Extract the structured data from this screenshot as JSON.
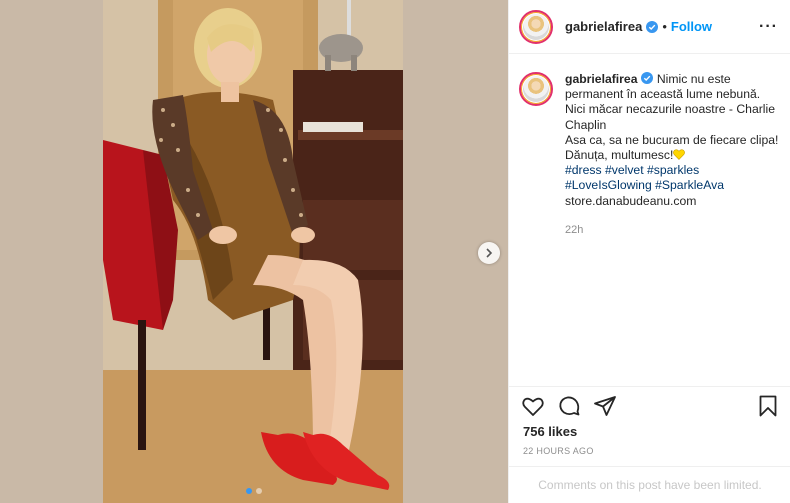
{
  "post": {
    "username": "gabrielafirea",
    "follow_label": "Follow",
    "header_separator": "•",
    "more_label": "···",
    "caption": {
      "username": "gabrielafirea",
      "line1": " Nimic nu este permanent în această lume nebună. Nici măcar necazurile noastre - Charlie Chaplin",
      "line2": "Asa ca, sa ne bucuram de fiecare clipa! Dănuța, multumesc!",
      "hashtags": [
        "#dress",
        "#velvet",
        "#sparkles",
        "#LoveIsGlowing",
        "#SparkleAva"
      ],
      "link": "store.danabudeanu.com",
      "time": "22h"
    },
    "likes": "756 likes",
    "time_ago": "22 HOURS AGO",
    "comments_limited": "Comments on this post have been limited."
  },
  "icons": {
    "verified": "verified-badge-icon",
    "like": "heart-icon",
    "comment": "comment-bubble-icon",
    "share": "paper-plane-icon",
    "save": "bookmark-icon",
    "next": "chevron-right-icon",
    "emoji": "yellow-heart-emoji"
  },
  "carousel": {
    "slides": 2,
    "current": 1
  },
  "colors": {
    "accent": "#0095f6",
    "tag": "#00376b",
    "muted": "#8e8e8e",
    "verified": "#3897f0"
  }
}
